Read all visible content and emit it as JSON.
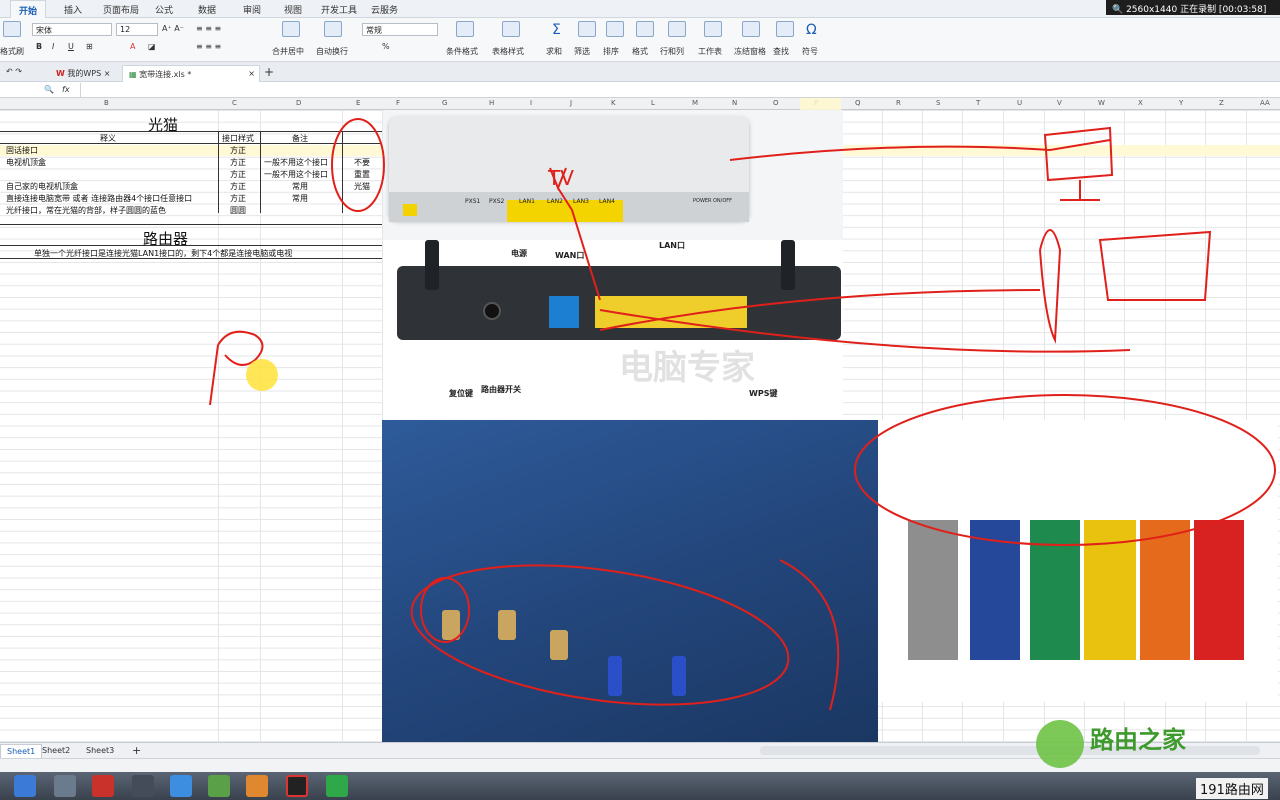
{
  "tabs": [
    "开始",
    "插入",
    "页面布局",
    "公式",
    "数据",
    "审阅",
    "视图",
    "开发工具",
    "云服务"
  ],
  "recording": "2560x1440  正在录制 [00:03:58]",
  "ribbon": {
    "format_painter": "格式刷",
    "font_name": "宋体",
    "font_size": "12",
    "merge_center": "合并居中",
    "wrap_text": "自动换行",
    "number_format": "常规",
    "percent": "%",
    "cond_format": "条件格式",
    "table_style": "表格样式",
    "sum": "求和",
    "filter": "筛选",
    "sort": "排序",
    "format": "格式",
    "row_col": "行和列",
    "worksheet": "工作表",
    "freeze": "冻结窗格",
    "find": "查找",
    "symbol": "符号"
  },
  "doc_tabs": [
    "我的WPS",
    "宽带连接.xls *"
  ],
  "columns": [
    "B",
    "C",
    "D",
    "E",
    "F",
    "G",
    "H",
    "I",
    "J",
    "K",
    "L",
    "M",
    "N",
    "O",
    "P",
    "Q",
    "R",
    "S",
    "T",
    "U",
    "V",
    "W",
    "X",
    "Y",
    "Z",
    "AA"
  ],
  "sheet": {
    "title_modem": "光猫",
    "hdr_meaning": "释义",
    "hdr_style": "接口样式",
    "hdr_note": "备注",
    "rows": [
      {
        "meaning": "固话接口",
        "style": "方正",
        "note": ""
      },
      {
        "meaning": "电视机顶盒",
        "style": "方正",
        "note": "一般不用这个接口"
      },
      {
        "meaning": "",
        "style": "方正",
        "note": "一般不用这个接口"
      },
      {
        "meaning": "自己家的电视机顶盒",
        "style": "方正",
        "note": "常用"
      },
      {
        "meaning": "直接连接电脑宽带  或者  连接路由器4个接口任意接口",
        "style": "方正",
        "note": "常用"
      },
      {
        "meaning": "光纤接口，常在光猫的背部，样子圆圆的蓝色",
        "style": "圆圆",
        "note": ""
      }
    ],
    "side_notes": [
      "不要",
      "重置",
      "光猫"
    ],
    "title_router": "路由器",
    "router_desc": "单独一个光纤接口是连接光猫LAN1接口的，剩下4个都是连接电脑或电视"
  },
  "photo1": {
    "ports": [
      "PXS1",
      "PXS2",
      "LAN1",
      "LAN2",
      "LAN3",
      "LAN4"
    ],
    "labels": [
      "POWER",
      "ON/OFF"
    ]
  },
  "photo2": {
    "power": "电源",
    "wan": "WAN口",
    "lan": "LAN口",
    "reset": "复位键",
    "switch": "路由器开关",
    "wps": "WPS键",
    "watermark": "电脑专家"
  },
  "annot_tv": "TV",
  "sheet_tabs": [
    "Sheet1",
    "Sheet2",
    "Sheet3"
  ],
  "watermark": "路由之家",
  "corner": "191路由网"
}
